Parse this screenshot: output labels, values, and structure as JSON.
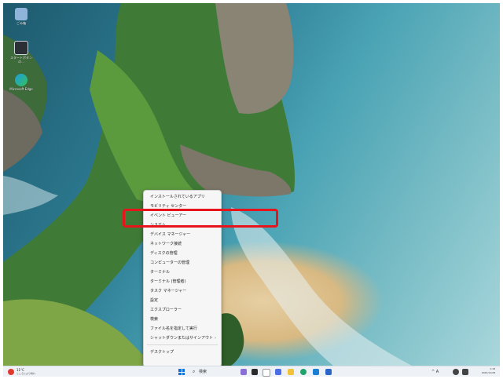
{
  "desktop": {
    "icons": [
      {
        "name": "recycle-bin",
        "label": "ごみ箱"
      },
      {
        "name": "app-shortcut",
        "label": "スタートボタンの..."
      },
      {
        "name": "edge",
        "label": "Microsoft Edge"
      }
    ]
  },
  "context_menu": {
    "items": [
      {
        "label": "インストールされているアプリ"
      },
      {
        "label": "モビリティ センター"
      },
      {
        "label": "イベント ビューアー"
      },
      {
        "label": "システム"
      },
      {
        "label": "デバイス マネージャー"
      },
      {
        "label": "ネットワーク接続"
      },
      {
        "label": "ディスクの管理"
      },
      {
        "label": "コンピューターの管理"
      },
      {
        "label": "ターミナル"
      },
      {
        "label": "ターミナル (管理者)"
      },
      {
        "label": "タスク マネージャー"
      },
      {
        "label": "設定"
      },
      {
        "label": "エクスプローラー"
      },
      {
        "label": "検索"
      },
      {
        "label": "ファイル名を指定して実行"
      },
      {
        "label": "シャットダウンまたはサインアウト",
        "submenu": "›"
      },
      {
        "label": "デスクトップ"
      }
    ]
  },
  "taskbar": {
    "weather_temp": "11°C",
    "weather_desc": "ところにより晴れ",
    "search_icon": "magnifier-icon",
    "search_label": "検索",
    "tray_text": "^ A",
    "time": "1:18",
    "date": "2023/11/28"
  },
  "colors": {
    "highlight": "#e8141c",
    "windows_blue": "#1672d8"
  }
}
